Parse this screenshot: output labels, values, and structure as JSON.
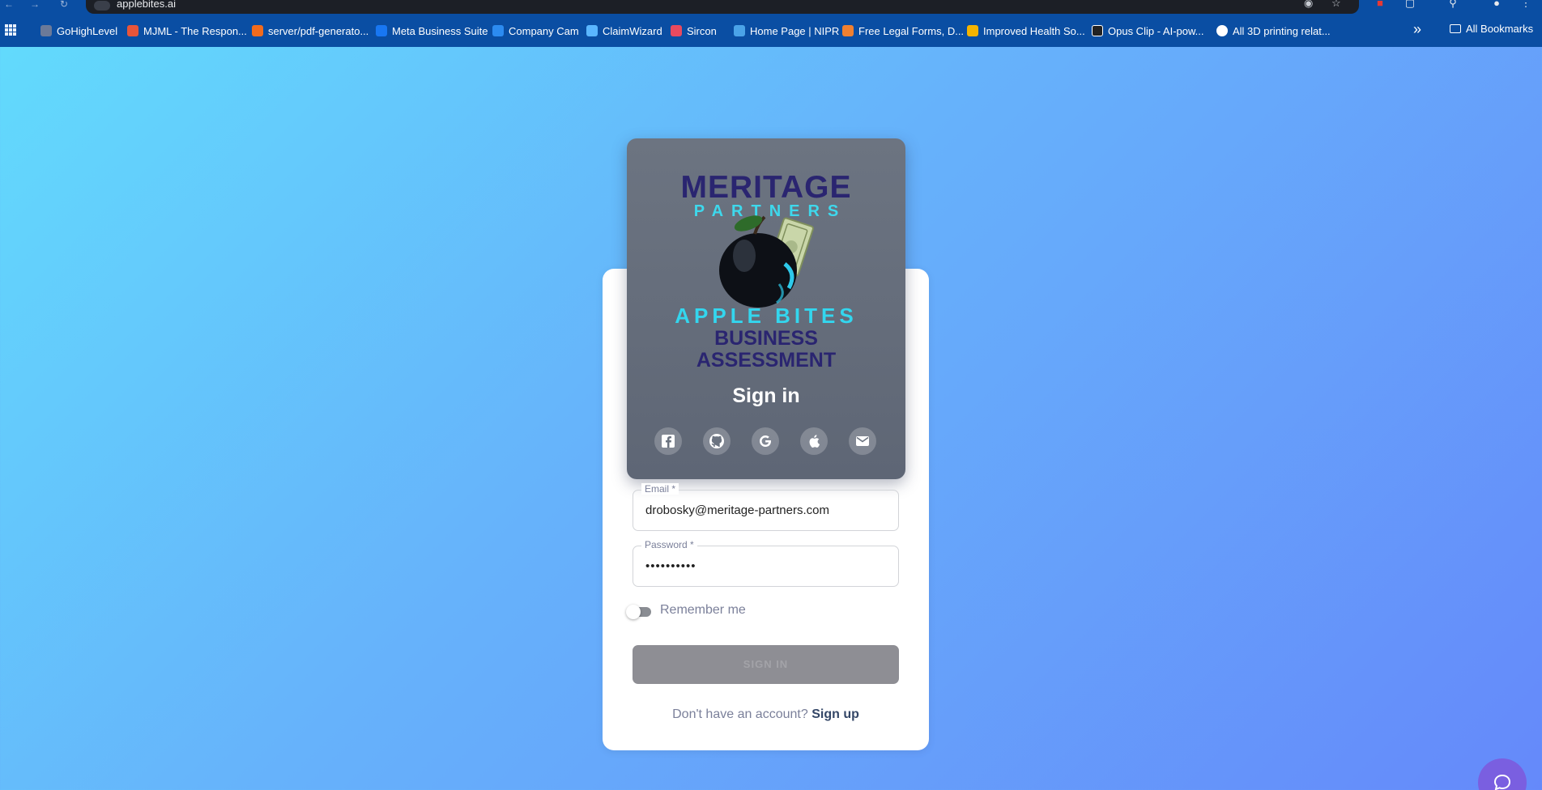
{
  "browser": {
    "url": "applebites.ai",
    "bookmarks": [
      {
        "label": "GoHighLevel",
        "color": "#6b7a99"
      },
      {
        "label": "MJML - The Respon...",
        "color": "#e8553a"
      },
      {
        "label": "server/pdf-generato...",
        "color": "#f26b1d"
      },
      {
        "label": "Meta Business Suite",
        "color": "#1877f2"
      },
      {
        "label": "Company Cam",
        "color": "#2c8bf0"
      },
      {
        "label": "ClaimWizard",
        "color": "#5ab6ff"
      },
      {
        "label": "Sircon",
        "color": "#e84a5f"
      },
      {
        "label": "Home Page | NIPR",
        "color": "#4aa3e8"
      },
      {
        "label": "Free Legal Forms, D...",
        "color": "#f08030"
      },
      {
        "label": "Improved Health So...",
        "color": "#f5b400"
      },
      {
        "label": "Opus Clip - AI-pow...",
        "color": "#222222"
      },
      {
        "label": "All 3D printing relat...",
        "color": "#ffffff"
      }
    ],
    "all_bookmarks": "All Bookmarks"
  },
  "logo": {
    "line1": "MERITAGE",
    "line2": "PARTNERS",
    "line3": "APPLE BITES",
    "line4": "BUSINESS",
    "line5": "ASSESSMENT"
  },
  "signin": {
    "title": "Sign in",
    "social": [
      "facebook-icon",
      "github-icon",
      "google-icon",
      "apple-icon",
      "email-icon"
    ]
  },
  "form": {
    "email_label": "Email *",
    "email_value": "drobosky@meritage-partners.com",
    "password_label": "Password *",
    "password_value": "••••••••••",
    "remember_label": "Remember me",
    "remember_checked": false,
    "submit_label": "SIGN IN",
    "footer_text": "Don't have an account?",
    "footer_link": "Sign up"
  },
  "colors": {
    "background_start": "#62dcfc",
    "background_end": "#6589fa",
    "logo_navy": "#2a2570",
    "logo_cyan": "#33d6ee"
  }
}
